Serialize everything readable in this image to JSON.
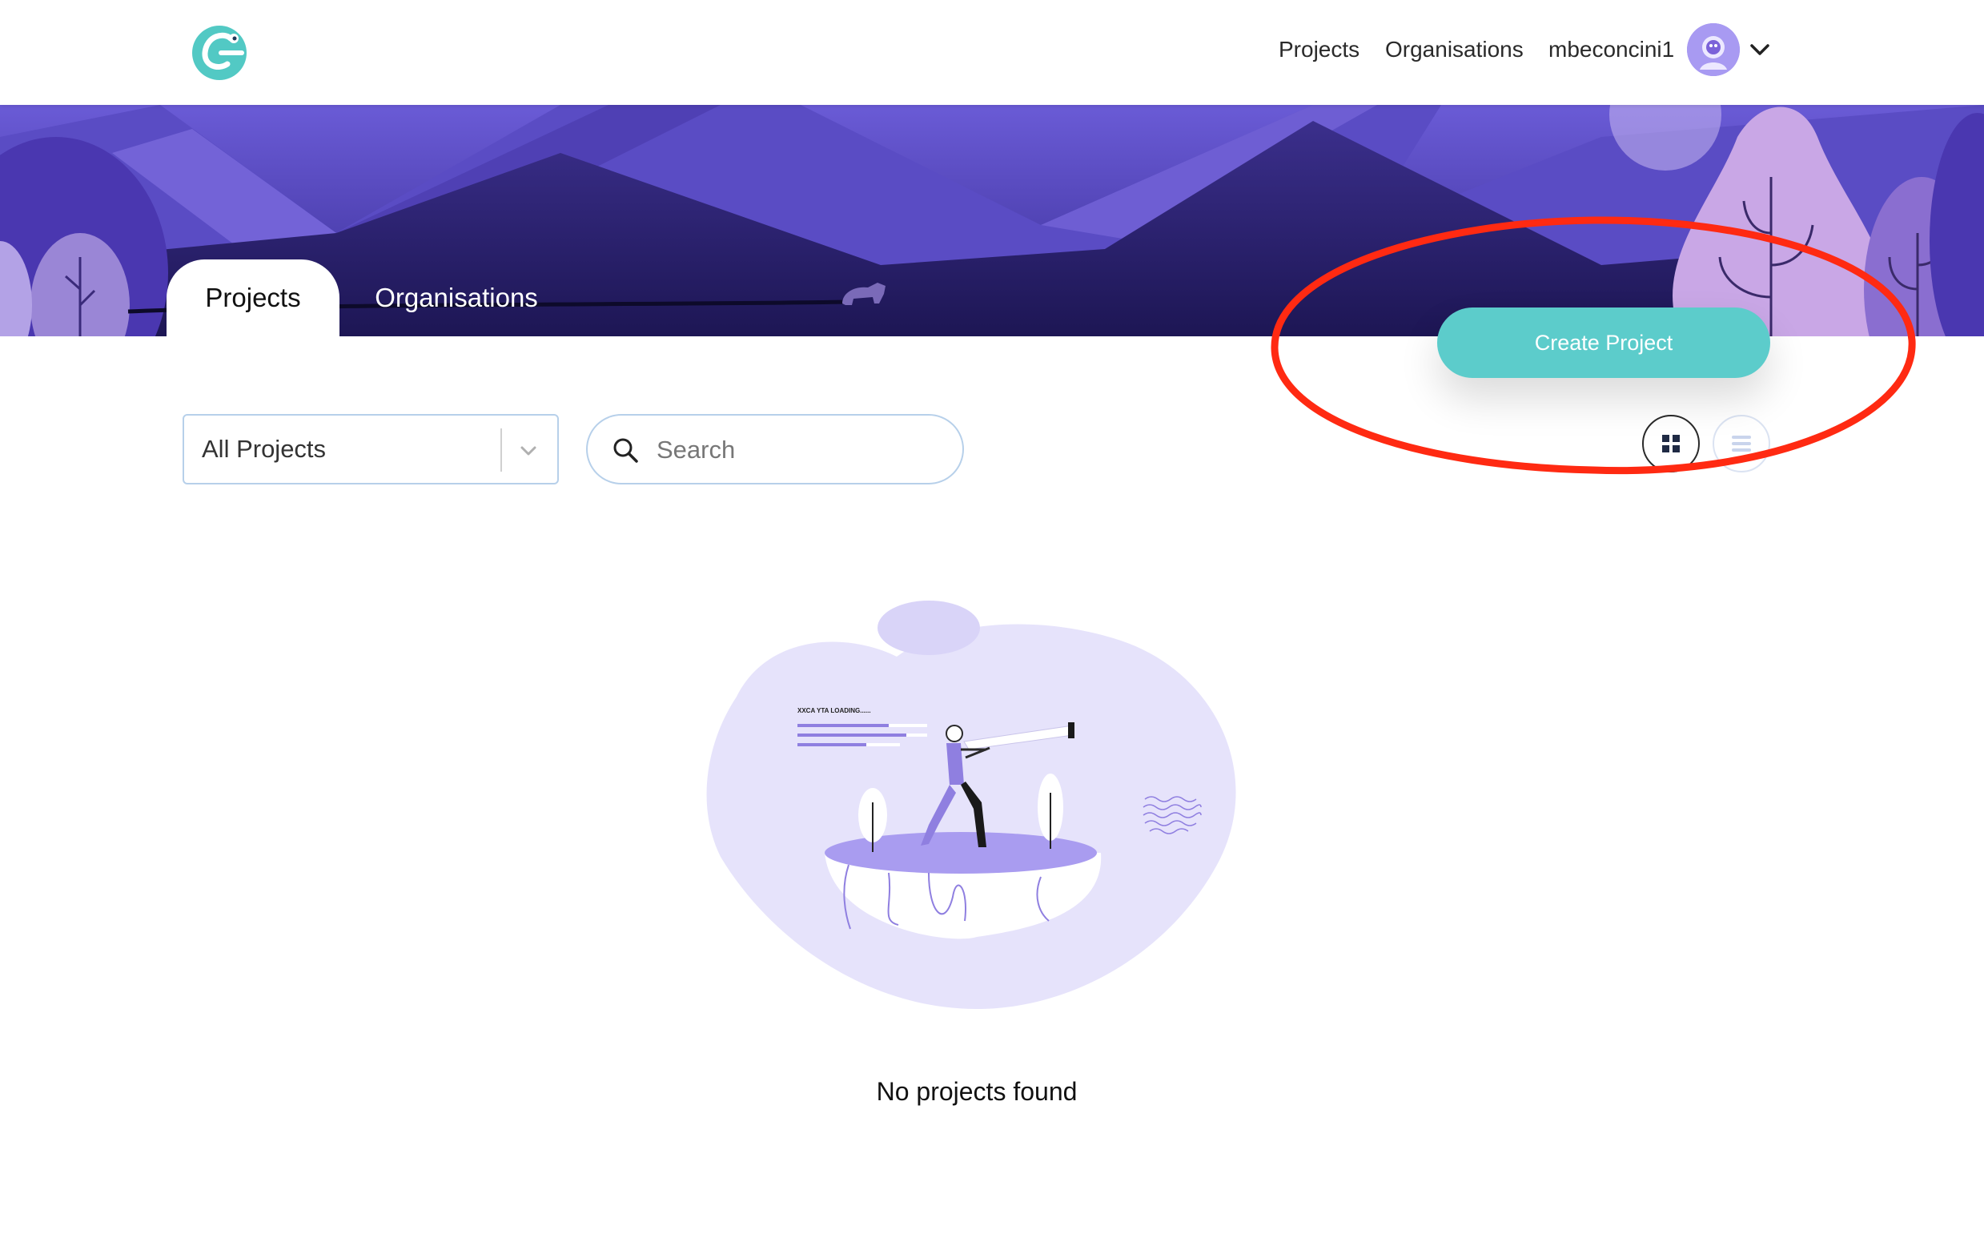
{
  "nav": {
    "projects_label": "Projects",
    "organisations_label": "Organisations",
    "username": "mbeconcini1"
  },
  "tabs": [
    {
      "label": "Projects",
      "active": true
    },
    {
      "label": "Organisations",
      "active": false
    }
  ],
  "create_button_label": "Create Project",
  "filter": {
    "selected": "All Projects"
  },
  "search": {
    "placeholder": "Search",
    "value": ""
  },
  "view_modes": [
    "grid",
    "list"
  ],
  "active_view": "grid",
  "empty_state": {
    "illustration_text": "XXCA YTA LOADING......",
    "message": "No projects found"
  },
  "colors": {
    "accent": "#5ccccb",
    "hero_primary": "#5b4cc0",
    "hero_dark": "#2a1f6e",
    "annotation": "#ff2a12",
    "illustration_bg": "#e6e3fb"
  },
  "icons": {
    "logo": "chameleon-logo-icon",
    "user_menu": "chevron-down-icon",
    "filter": "chevron-down-icon",
    "search": "search-icon",
    "grid_view": "grid-view-icon",
    "list_view": "list-view-icon"
  }
}
